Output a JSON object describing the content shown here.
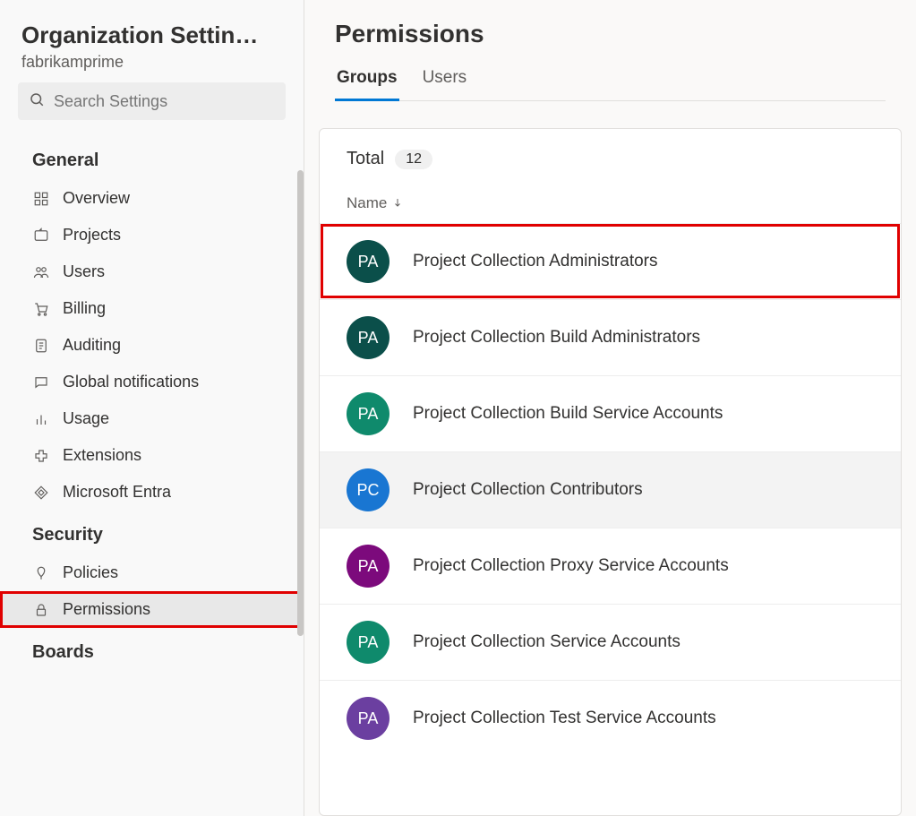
{
  "sidebar": {
    "title": "Organization Settin…",
    "subtitle": "fabrikamprime",
    "search_placeholder": "Search Settings",
    "sections": [
      {
        "heading": "General",
        "items": [
          {
            "label": "Overview",
            "icon": "overview"
          },
          {
            "label": "Projects",
            "icon": "projects"
          },
          {
            "label": "Users",
            "icon": "users"
          },
          {
            "label": "Billing",
            "icon": "billing"
          },
          {
            "label": "Auditing",
            "icon": "auditing"
          },
          {
            "label": "Global notifications",
            "icon": "notifications"
          },
          {
            "label": "Usage",
            "icon": "usage"
          },
          {
            "label": "Extensions",
            "icon": "extensions"
          },
          {
            "label": "Microsoft Entra",
            "icon": "entra"
          }
        ]
      },
      {
        "heading": "Security",
        "items": [
          {
            "label": "Policies",
            "icon": "policies"
          },
          {
            "label": "Permissions",
            "icon": "permissions",
            "selected": true,
            "highlight": true
          }
        ]
      },
      {
        "heading": "Boards",
        "items": []
      }
    ]
  },
  "main": {
    "title": "Permissions",
    "tabs": [
      {
        "label": "Groups",
        "active": true
      },
      {
        "label": "Users",
        "active": false
      }
    ],
    "total_label": "Total",
    "total_count": "12",
    "column_header": "Name",
    "groups": [
      {
        "initials": "PA",
        "color": "#0b4f4a",
        "name": "Project Collection Administrators",
        "highlight": true
      },
      {
        "initials": "PA",
        "color": "#0b4f4a",
        "name": "Project Collection Build Administrators"
      },
      {
        "initials": "PA",
        "color": "#0f8a6c",
        "name": "Project Collection Build Service Accounts"
      },
      {
        "initials": "PC",
        "color": "#1976d2",
        "name": "Project Collection Contributors",
        "hover": true
      },
      {
        "initials": "PA",
        "color": "#7c0a7c",
        "name": "Project Collection Proxy Service Accounts"
      },
      {
        "initials": "PA",
        "color": "#0f8a6c",
        "name": "Project Collection Service Accounts"
      },
      {
        "initials": "PA",
        "color": "#6b3fa0",
        "name": "Project Collection Test Service Accounts"
      }
    ]
  }
}
